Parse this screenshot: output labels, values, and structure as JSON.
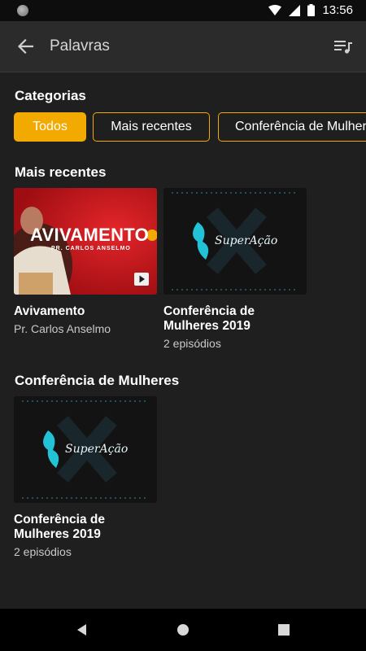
{
  "status_bar": {
    "time": "13:56"
  },
  "app_bar": {
    "title": "Palavras"
  },
  "categories": {
    "heading": "Categorias",
    "chips": [
      {
        "label": "Todos",
        "active": true
      },
      {
        "label": "Mais recentes",
        "active": false
      },
      {
        "label": "Conferência de Mulheres",
        "active": false
      }
    ]
  },
  "recent": {
    "heading": "Mais recentes",
    "items": [
      {
        "thumb_text": "AVIVAMENTO",
        "thumb_subtext": "PR. CARLOS ANSELMO",
        "title": "Avivamento",
        "subtitle": "Pr. Carlos Anselmo"
      },
      {
        "thumb_text": "SuperAção",
        "title": "Conferência de Mulheres 2019",
        "subtitle": "2 episódios"
      }
    ]
  },
  "conference": {
    "heading": "Conferência de Mulheres",
    "items": [
      {
        "thumb_text": "SuperAção",
        "title": "Conferência de Mulheres 2019",
        "subtitle": "2 episódios"
      }
    ]
  },
  "colors": {
    "accent": "#f2a900",
    "background": "#1f1f1f",
    "app_bar": "#2b2b2b",
    "thumb_red": "#c4151b",
    "logo_teal": "#22c3d6"
  }
}
